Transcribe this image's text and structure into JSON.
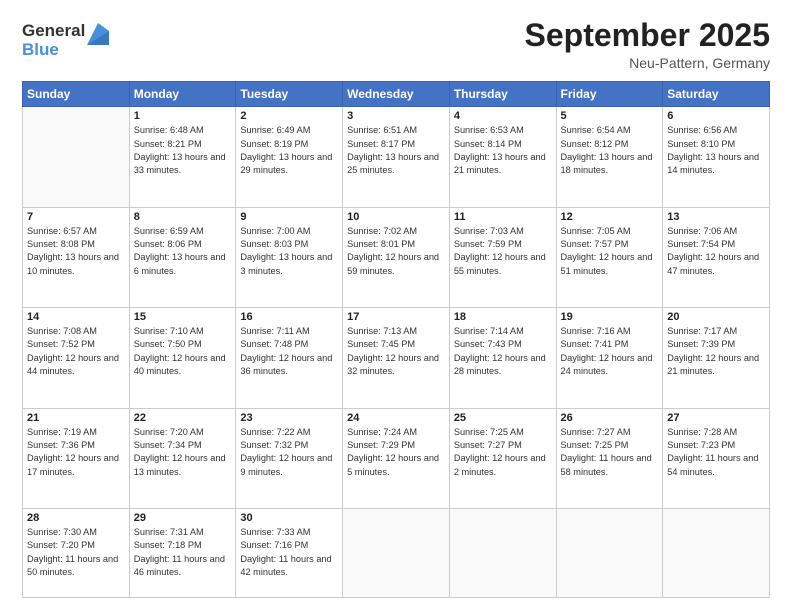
{
  "logo": {
    "general": "General",
    "blue": "Blue"
  },
  "header": {
    "month": "September 2025",
    "location": "Neu-Pattern, Germany"
  },
  "weekdays": [
    "Sunday",
    "Monday",
    "Tuesday",
    "Wednesday",
    "Thursday",
    "Friday",
    "Saturday"
  ],
  "weeks": [
    [
      {
        "day": "",
        "sunrise": "",
        "sunset": "",
        "daylight": ""
      },
      {
        "day": "1",
        "sunrise": "Sunrise: 6:48 AM",
        "sunset": "Sunset: 8:21 PM",
        "daylight": "Daylight: 13 hours and 33 minutes."
      },
      {
        "day": "2",
        "sunrise": "Sunrise: 6:49 AM",
        "sunset": "Sunset: 8:19 PM",
        "daylight": "Daylight: 13 hours and 29 minutes."
      },
      {
        "day": "3",
        "sunrise": "Sunrise: 6:51 AM",
        "sunset": "Sunset: 8:17 PM",
        "daylight": "Daylight: 13 hours and 25 minutes."
      },
      {
        "day": "4",
        "sunrise": "Sunrise: 6:53 AM",
        "sunset": "Sunset: 8:14 PM",
        "daylight": "Daylight: 13 hours and 21 minutes."
      },
      {
        "day": "5",
        "sunrise": "Sunrise: 6:54 AM",
        "sunset": "Sunset: 8:12 PM",
        "daylight": "Daylight: 13 hours and 18 minutes."
      },
      {
        "day": "6",
        "sunrise": "Sunrise: 6:56 AM",
        "sunset": "Sunset: 8:10 PM",
        "daylight": "Daylight: 13 hours and 14 minutes."
      }
    ],
    [
      {
        "day": "7",
        "sunrise": "Sunrise: 6:57 AM",
        "sunset": "Sunset: 8:08 PM",
        "daylight": "Daylight: 13 hours and 10 minutes."
      },
      {
        "day": "8",
        "sunrise": "Sunrise: 6:59 AM",
        "sunset": "Sunset: 8:06 PM",
        "daylight": "Daylight: 13 hours and 6 minutes."
      },
      {
        "day": "9",
        "sunrise": "Sunrise: 7:00 AM",
        "sunset": "Sunset: 8:03 PM",
        "daylight": "Daylight: 13 hours and 3 minutes."
      },
      {
        "day": "10",
        "sunrise": "Sunrise: 7:02 AM",
        "sunset": "Sunset: 8:01 PM",
        "daylight": "Daylight: 12 hours and 59 minutes."
      },
      {
        "day": "11",
        "sunrise": "Sunrise: 7:03 AM",
        "sunset": "Sunset: 7:59 PM",
        "daylight": "Daylight: 12 hours and 55 minutes."
      },
      {
        "day": "12",
        "sunrise": "Sunrise: 7:05 AM",
        "sunset": "Sunset: 7:57 PM",
        "daylight": "Daylight: 12 hours and 51 minutes."
      },
      {
        "day": "13",
        "sunrise": "Sunrise: 7:06 AM",
        "sunset": "Sunset: 7:54 PM",
        "daylight": "Daylight: 12 hours and 47 minutes."
      }
    ],
    [
      {
        "day": "14",
        "sunrise": "Sunrise: 7:08 AM",
        "sunset": "Sunset: 7:52 PM",
        "daylight": "Daylight: 12 hours and 44 minutes."
      },
      {
        "day": "15",
        "sunrise": "Sunrise: 7:10 AM",
        "sunset": "Sunset: 7:50 PM",
        "daylight": "Daylight: 12 hours and 40 minutes."
      },
      {
        "day": "16",
        "sunrise": "Sunrise: 7:11 AM",
        "sunset": "Sunset: 7:48 PM",
        "daylight": "Daylight: 12 hours and 36 minutes."
      },
      {
        "day": "17",
        "sunrise": "Sunrise: 7:13 AM",
        "sunset": "Sunset: 7:45 PM",
        "daylight": "Daylight: 12 hours and 32 minutes."
      },
      {
        "day": "18",
        "sunrise": "Sunrise: 7:14 AM",
        "sunset": "Sunset: 7:43 PM",
        "daylight": "Daylight: 12 hours and 28 minutes."
      },
      {
        "day": "19",
        "sunrise": "Sunrise: 7:16 AM",
        "sunset": "Sunset: 7:41 PM",
        "daylight": "Daylight: 12 hours and 24 minutes."
      },
      {
        "day": "20",
        "sunrise": "Sunrise: 7:17 AM",
        "sunset": "Sunset: 7:39 PM",
        "daylight": "Daylight: 12 hours and 21 minutes."
      }
    ],
    [
      {
        "day": "21",
        "sunrise": "Sunrise: 7:19 AM",
        "sunset": "Sunset: 7:36 PM",
        "daylight": "Daylight: 12 hours and 17 minutes."
      },
      {
        "day": "22",
        "sunrise": "Sunrise: 7:20 AM",
        "sunset": "Sunset: 7:34 PM",
        "daylight": "Daylight: 12 hours and 13 minutes."
      },
      {
        "day": "23",
        "sunrise": "Sunrise: 7:22 AM",
        "sunset": "Sunset: 7:32 PM",
        "daylight": "Daylight: 12 hours and 9 minutes."
      },
      {
        "day": "24",
        "sunrise": "Sunrise: 7:24 AM",
        "sunset": "Sunset: 7:29 PM",
        "daylight": "Daylight: 12 hours and 5 minutes."
      },
      {
        "day": "25",
        "sunrise": "Sunrise: 7:25 AM",
        "sunset": "Sunset: 7:27 PM",
        "daylight": "Daylight: 12 hours and 2 minutes."
      },
      {
        "day": "26",
        "sunrise": "Sunrise: 7:27 AM",
        "sunset": "Sunset: 7:25 PM",
        "daylight": "Daylight: 11 hours and 58 minutes."
      },
      {
        "day": "27",
        "sunrise": "Sunrise: 7:28 AM",
        "sunset": "Sunset: 7:23 PM",
        "daylight": "Daylight: 11 hours and 54 minutes."
      }
    ],
    [
      {
        "day": "28",
        "sunrise": "Sunrise: 7:30 AM",
        "sunset": "Sunset: 7:20 PM",
        "daylight": "Daylight: 11 hours and 50 minutes."
      },
      {
        "day": "29",
        "sunrise": "Sunrise: 7:31 AM",
        "sunset": "Sunset: 7:18 PM",
        "daylight": "Daylight: 11 hours and 46 minutes."
      },
      {
        "day": "30",
        "sunrise": "Sunrise: 7:33 AM",
        "sunset": "Sunset: 7:16 PM",
        "daylight": "Daylight: 11 hours and 42 minutes."
      },
      {
        "day": "",
        "sunrise": "",
        "sunset": "",
        "daylight": ""
      },
      {
        "day": "",
        "sunrise": "",
        "sunset": "",
        "daylight": ""
      },
      {
        "day": "",
        "sunrise": "",
        "sunset": "",
        "daylight": ""
      },
      {
        "day": "",
        "sunrise": "",
        "sunset": "",
        "daylight": ""
      }
    ]
  ]
}
